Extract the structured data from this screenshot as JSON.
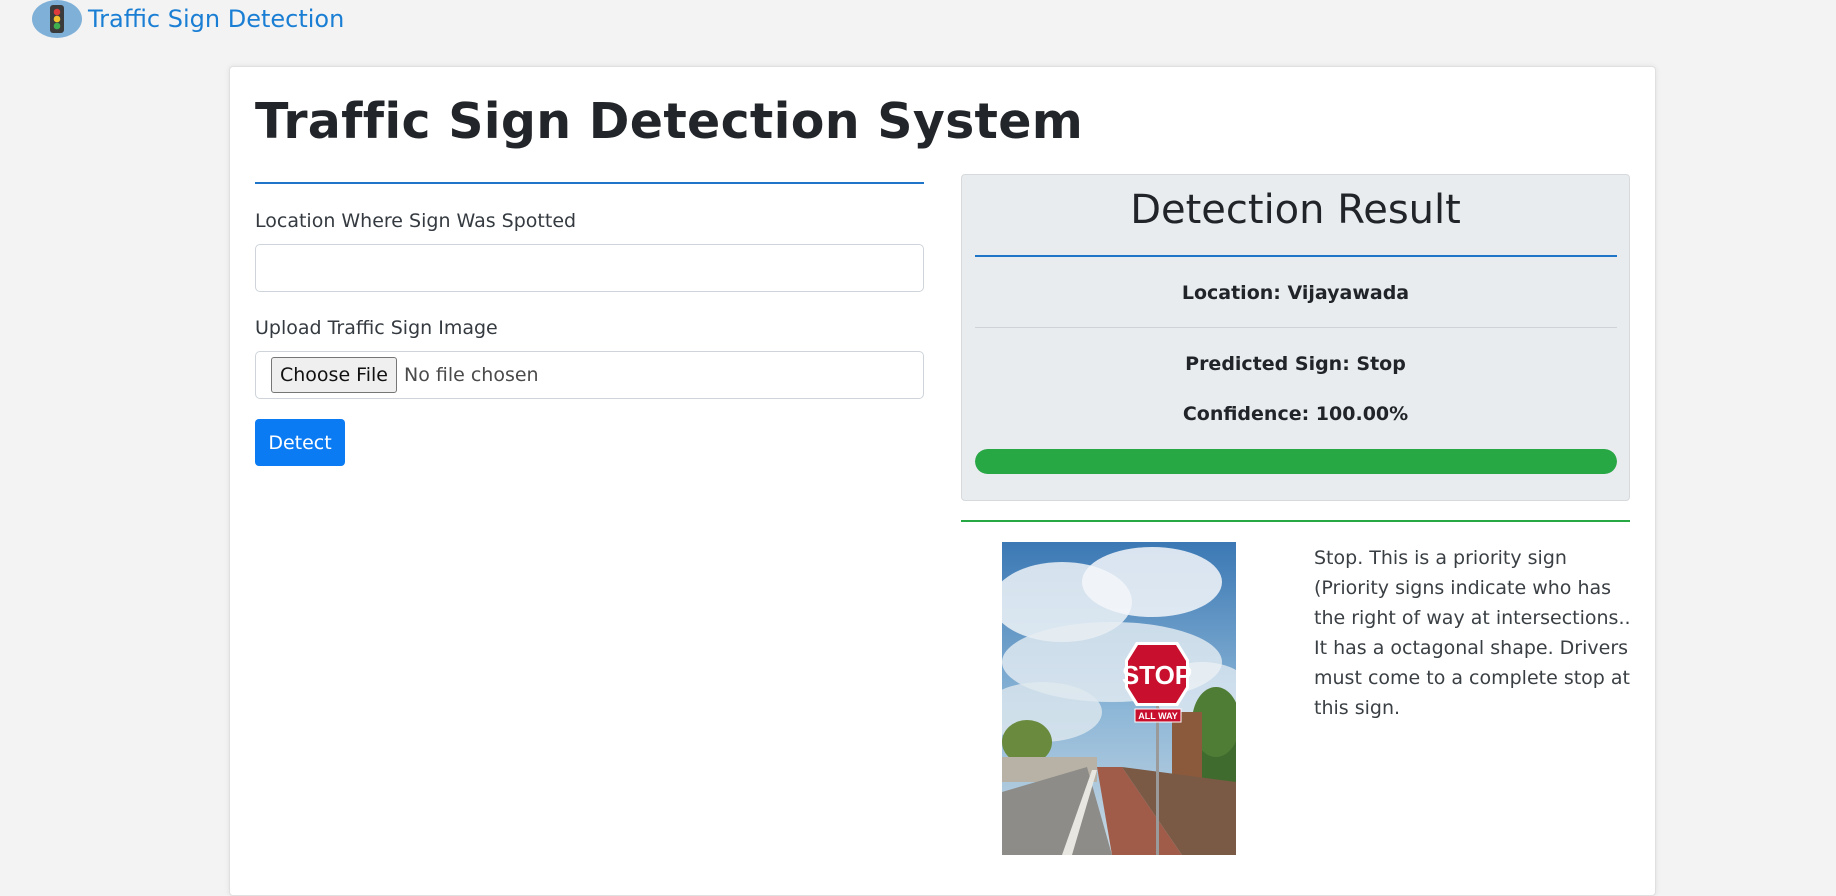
{
  "navbar": {
    "brand": "Traffic Sign Detection",
    "icon": "traffic-light-icon"
  },
  "page": {
    "title": "Traffic Sign Detection System"
  },
  "form": {
    "location_label": "Location Where Sign Was Spotted",
    "location_value": "",
    "upload_label": "Upload Traffic Sign Image",
    "file_button": "Choose File",
    "file_status": "No file chosen",
    "submit_label": "Detect"
  },
  "result": {
    "title": "Detection Result",
    "location": "Location: Vijayawada",
    "predicted": "Predicted Sign: Stop",
    "confidence": "Confidence: 100.00%",
    "confidence_value": 1.0
  },
  "sign_image": {
    "sign_text": "STOP",
    "plate_text": "ALL WAY"
  },
  "description": "Stop. This is a priority sign (Priority signs indicate who has the right of way at intersections.. It has a octagonal shape. Drivers must come to a complete stop at this sign.",
  "colors": {
    "accent": "#1f75c8",
    "button": "#0b7bf4",
    "success": "#28a745",
    "sign_red": "#c8102e"
  }
}
